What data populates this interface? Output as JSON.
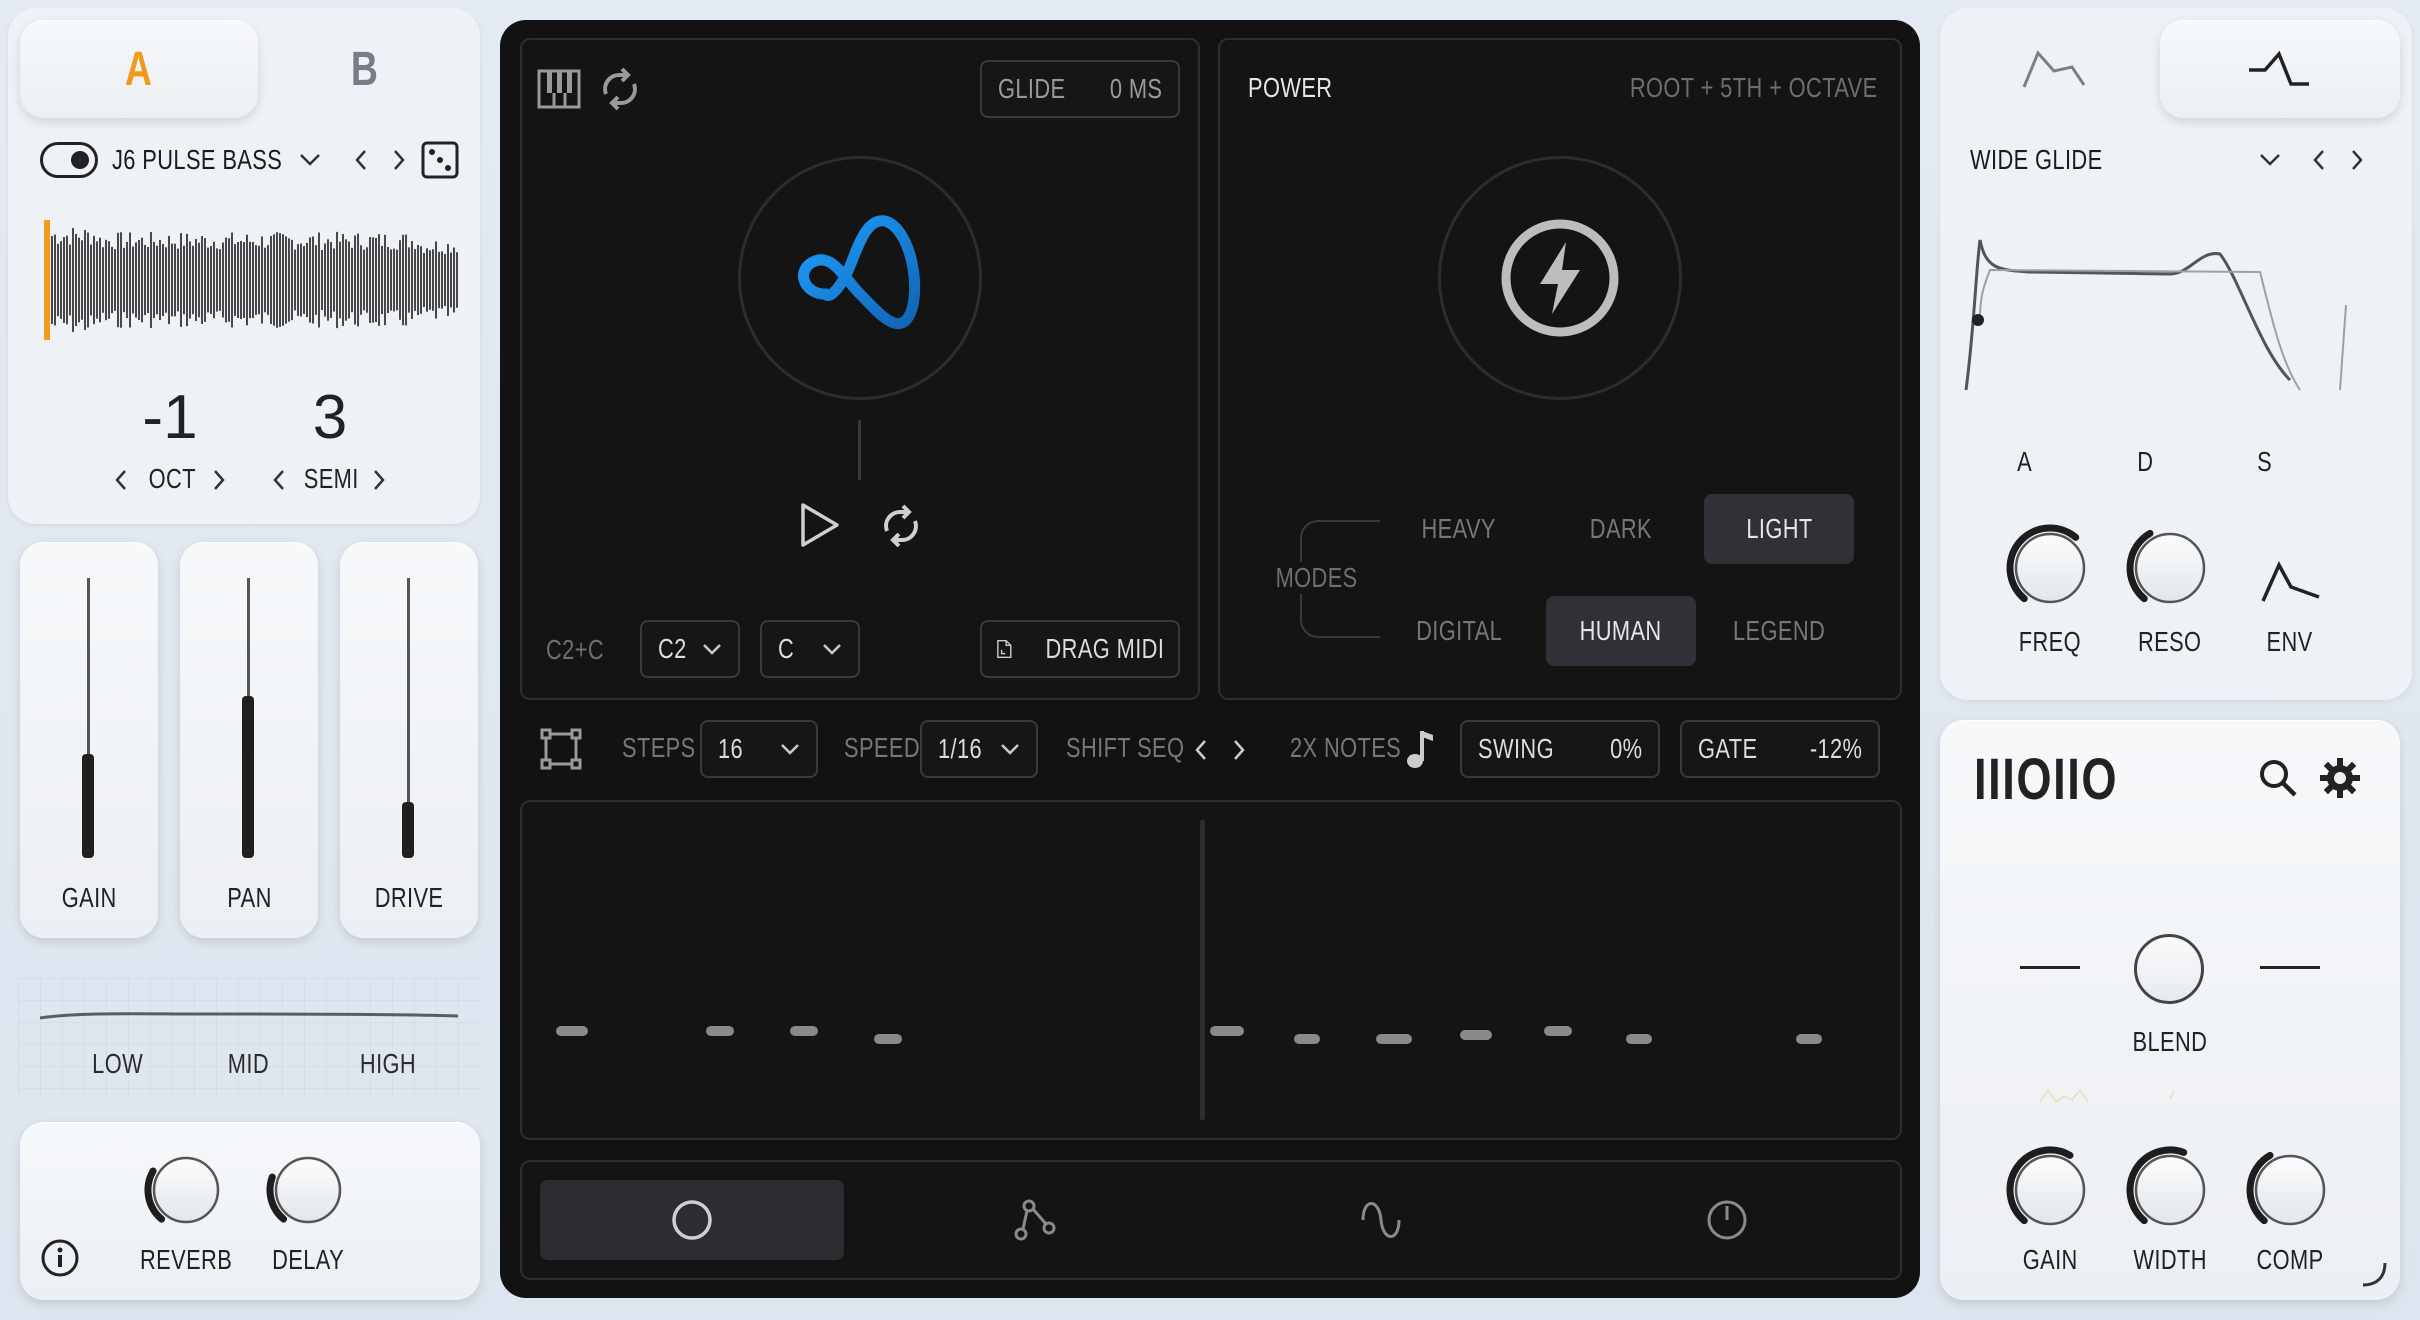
{
  "layer_tabs": {
    "a": "A",
    "b": "B"
  },
  "left": {
    "preset_name": "J6 PULSE BASS",
    "oct_value": "-1",
    "oct_label": "OCT",
    "semi_value": "3",
    "semi_label": "SEMI",
    "faders": [
      {
        "label": "GAIN",
        "level": 0.37
      },
      {
        "label": "PAN",
        "level": 0.58
      },
      {
        "label": "DRIVE",
        "level": 0.2
      }
    ],
    "eq": {
      "low": "LOW",
      "mid": "MID",
      "high": "HIGH"
    },
    "fx": {
      "reverb": "REVERB",
      "delay": "DELAY"
    }
  },
  "center": {
    "glide_label": "GLIDE",
    "glide_value": "0 MS",
    "range_label": "C2+C",
    "octave_select": "C2",
    "key_select": "C",
    "drag_midi": "DRAG MIDI",
    "chord_name": "POWER",
    "chord_desc": "ROOT + 5TH + OCTAVE",
    "modes_label": "MODES",
    "modes": [
      {
        "label": "HEAVY",
        "active": false
      },
      {
        "label": "DARK",
        "active": false
      },
      {
        "label": "LIGHT",
        "active": true
      },
      {
        "label": "DIGITAL",
        "active": false
      },
      {
        "label": "HUMAN",
        "active": true
      },
      {
        "label": "LEGEND",
        "active": false
      }
    ],
    "seq": {
      "steps_label": "STEPS",
      "steps_value": "16",
      "speed_label": "SPEED",
      "speed_value": "1/16",
      "shift_label": "SHIFT SEQ",
      "notes_label": "2X NOTES",
      "swing_label": "SWING",
      "swing_value": "0%",
      "gate_label": "GATE",
      "gate_value": "-12%"
    }
  },
  "right": {
    "preset_name": "WIDE GLIDE",
    "adsr": {
      "a": "A",
      "d": "D",
      "s": "S"
    },
    "filter": {
      "freq": "FREQ",
      "reso": "RESO",
      "env": "ENV"
    },
    "logo": "IIIOIIO",
    "blend_label": "BLEND",
    "master": {
      "gain": "GAIN",
      "width": "WIDTH",
      "comp": "COMP"
    }
  },
  "colors": {
    "accent_orange": "#f39a1c",
    "accent_blue": "#1e8fe6",
    "dark_bg": "#121212"
  }
}
